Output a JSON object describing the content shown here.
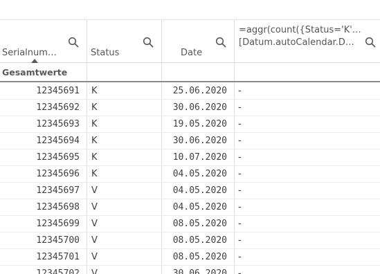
{
  "table": {
    "columns": [
      {
        "label": "Serialnum…",
        "sorted": "ascending"
      },
      {
        "label": "Status"
      },
      {
        "label": "Date"
      },
      {
        "label_line1": "=aggr(count({Status='K'…",
        "label_line2": "[Datum.autoCalendar.D…"
      }
    ],
    "totals_label": "Gesamtwerte",
    "rows": [
      {
        "serial": "12345691",
        "status": "K",
        "date": "25.06.2020",
        "value": "-"
      },
      {
        "serial": "12345692",
        "status": "K",
        "date": "30.06.2020",
        "value": "-"
      },
      {
        "serial": "12345693",
        "status": "K",
        "date": "19.05.2020",
        "value": "-"
      },
      {
        "serial": "12345694",
        "status": "K",
        "date": "30.06.2020",
        "value": "-"
      },
      {
        "serial": "12345695",
        "status": "K",
        "date": "10.07.2020",
        "value": "-"
      },
      {
        "serial": "12345696",
        "status": "K",
        "date": "04.05.2020",
        "value": "-"
      },
      {
        "serial": "12345697",
        "status": "V",
        "date": "04.05.2020",
        "value": "-"
      },
      {
        "serial": "12345698",
        "status": "V",
        "date": "04.05.2020",
        "value": "-"
      },
      {
        "serial": "12345699",
        "status": "V",
        "date": "08.05.2020",
        "value": "-"
      },
      {
        "serial": "12345700",
        "status": "V",
        "date": "08.05.2020",
        "value": "-"
      },
      {
        "serial": "12345701",
        "status": "V",
        "date": "08.05.2020",
        "value": "-"
      },
      {
        "serial": "12345702",
        "status": "V",
        "date": "30.06.2020",
        "value": "-"
      }
    ]
  },
  "icons": {
    "search": "search-icon",
    "sort": "sort-ascending-icon"
  }
}
